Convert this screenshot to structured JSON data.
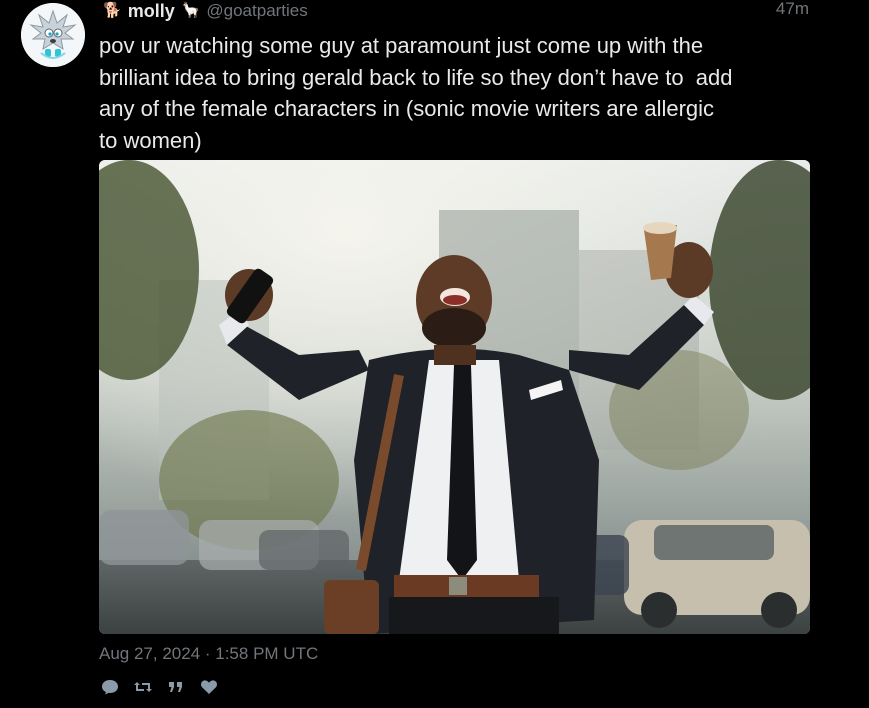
{
  "author": {
    "display_name": "molly",
    "handle": "@goatparties",
    "emoji_before": "🐕",
    "emoji_after": "🦙"
  },
  "tweet": {
    "relative_time": "47m",
    "text": "pov ur watching some guy at paramount just come up with the\nbrilliant idea to bring gerald back to life so they don’t have to  add\nany of the female characters in (sonic movie writers are allergic\nto women)",
    "date": "Aug 27, 2024 · 1:58 PM UTC"
  },
  "media": {
    "description_icon": "photo"
  },
  "actions": [
    {
      "name": "reply-icon"
    },
    {
      "name": "retweet-icon"
    },
    {
      "name": "quote-icon"
    },
    {
      "name": "like-icon"
    }
  ],
  "colors": {
    "background": "#000000",
    "text": "#e7e9ea",
    "muted": "#71767b",
    "action": "#8a9aa9"
  }
}
